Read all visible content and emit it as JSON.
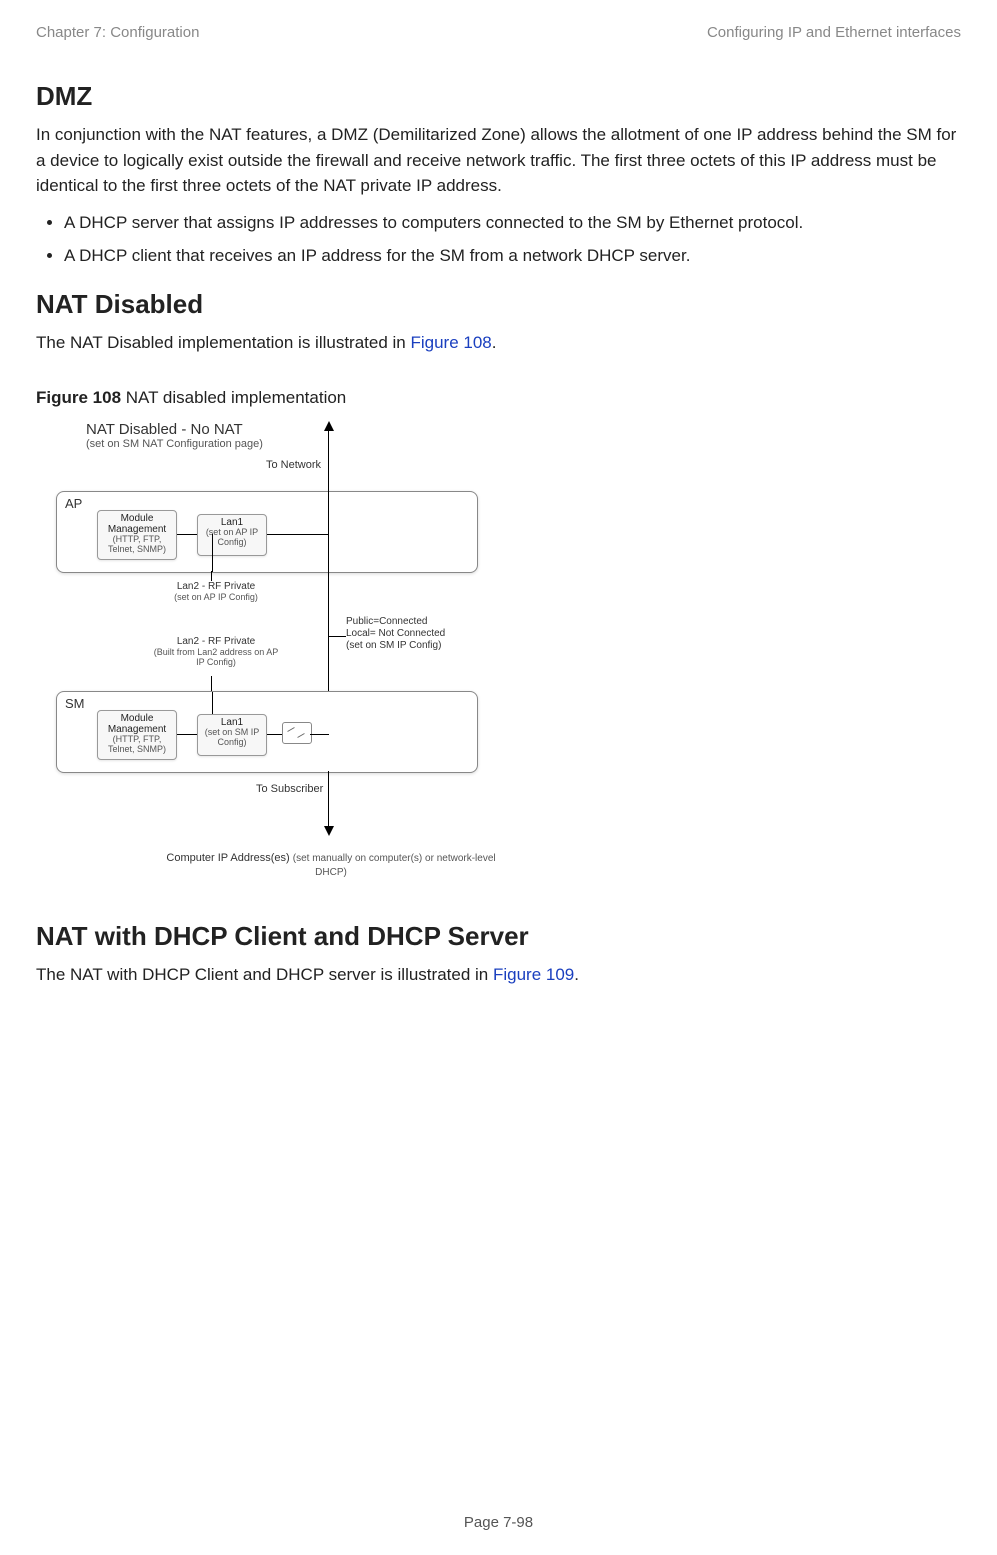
{
  "header": {
    "left": "Chapter 7:  Configuration",
    "right": "Configuring IP and Ethernet interfaces"
  },
  "sections": {
    "dmz": {
      "title": "DMZ",
      "body": "In conjunction with the NAT features, a DMZ (Demilitarized Zone) allows the allotment of one IP address behind the SM for a device to logically exist outside the firewall and receive network traffic. The first three octets of this IP address must be identical to the first three octets of the NAT private IP address.",
      "bullets": [
        "A DHCP server that assigns IP addresses to computers connected to the SM by Ethernet protocol.",
        "A DHCP client that receives an IP address for the SM from a network DHCP server."
      ]
    },
    "nat_disabled": {
      "title": "NAT Disabled",
      "body_pre": "The NAT Disabled implementation is illustrated in ",
      "link": "Figure 108",
      "body_post": "."
    },
    "nat_dhcp": {
      "title": "NAT with DHCP Client and DHCP Server",
      "body_pre": "The NAT with DHCP Client and DHCP server is illustrated in ",
      "link": "Figure 109",
      "body_post": "."
    }
  },
  "figure": {
    "caption_bold": "Figure 108",
    "caption_rest": " NAT disabled implementation",
    "title": "NAT Disabled - No NAT",
    "subtitle": "(set on SM NAT Configuration page)",
    "to_network": "To Network",
    "to_subscriber": "To Subscriber",
    "ap_label": "AP",
    "sm_label": "SM",
    "module_mgmt": "Module Management",
    "module_mgmt_sub": "(HTTP, FTP, Telnet, SNMP)",
    "lan1_ap": "Lan1",
    "lan1_ap_sub": "(set on AP IP Config)",
    "lan1_sm": "Lan1",
    "lan1_sm_sub": "(set on SM IP Config)",
    "lan2_top": "Lan2 - RF Private",
    "lan2_top_sub": "(set on AP IP Config)",
    "lan2_bottom": "Lan2 - RF Private",
    "lan2_bottom_sub": "(Built from Lan2 address on AP IP Config)",
    "pub_conn": "Public=Connected\nLocal= Not Connected\n(set on SM IP Config)",
    "comp_ip_bold": "Computer IP Address(es) ",
    "comp_ip_rest": "(set manually on computer(s) or network-level DHCP)"
  },
  "footer": "Page 7-98"
}
